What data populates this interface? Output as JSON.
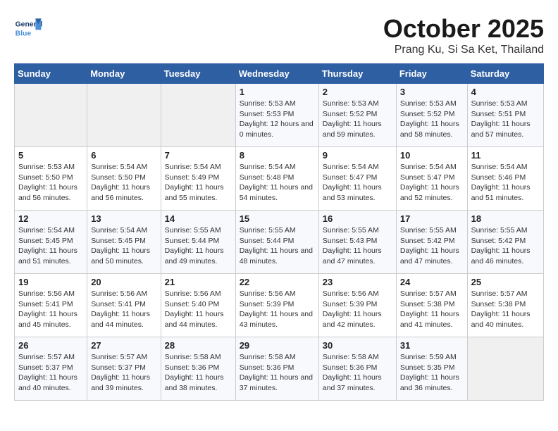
{
  "logo": {
    "general": "General",
    "blue": "Blue"
  },
  "title": "October 2025",
  "subtitle": "Prang Ku, Si Sa Ket, Thailand",
  "headers": [
    "Sunday",
    "Monday",
    "Tuesday",
    "Wednesday",
    "Thursday",
    "Friday",
    "Saturday"
  ],
  "weeks": [
    [
      {
        "day": "",
        "sunrise": "",
        "sunset": "",
        "daylight": ""
      },
      {
        "day": "",
        "sunrise": "",
        "sunset": "",
        "daylight": ""
      },
      {
        "day": "",
        "sunrise": "",
        "sunset": "",
        "daylight": ""
      },
      {
        "day": "1",
        "sunrise": "Sunrise: 5:53 AM",
        "sunset": "Sunset: 5:53 PM",
        "daylight": "Daylight: 12 hours and 0 minutes."
      },
      {
        "day": "2",
        "sunrise": "Sunrise: 5:53 AM",
        "sunset": "Sunset: 5:52 PM",
        "daylight": "Daylight: 11 hours and 59 minutes."
      },
      {
        "day": "3",
        "sunrise": "Sunrise: 5:53 AM",
        "sunset": "Sunset: 5:52 PM",
        "daylight": "Daylight: 11 hours and 58 minutes."
      },
      {
        "day": "4",
        "sunrise": "Sunrise: 5:53 AM",
        "sunset": "Sunset: 5:51 PM",
        "daylight": "Daylight: 11 hours and 57 minutes."
      }
    ],
    [
      {
        "day": "5",
        "sunrise": "Sunrise: 5:53 AM",
        "sunset": "Sunset: 5:50 PM",
        "daylight": "Daylight: 11 hours and 56 minutes."
      },
      {
        "day": "6",
        "sunrise": "Sunrise: 5:54 AM",
        "sunset": "Sunset: 5:50 PM",
        "daylight": "Daylight: 11 hours and 56 minutes."
      },
      {
        "day": "7",
        "sunrise": "Sunrise: 5:54 AM",
        "sunset": "Sunset: 5:49 PM",
        "daylight": "Daylight: 11 hours and 55 minutes."
      },
      {
        "day": "8",
        "sunrise": "Sunrise: 5:54 AM",
        "sunset": "Sunset: 5:48 PM",
        "daylight": "Daylight: 11 hours and 54 minutes."
      },
      {
        "day": "9",
        "sunrise": "Sunrise: 5:54 AM",
        "sunset": "Sunset: 5:47 PM",
        "daylight": "Daylight: 11 hours and 53 minutes."
      },
      {
        "day": "10",
        "sunrise": "Sunrise: 5:54 AM",
        "sunset": "Sunset: 5:47 PM",
        "daylight": "Daylight: 11 hours and 52 minutes."
      },
      {
        "day": "11",
        "sunrise": "Sunrise: 5:54 AM",
        "sunset": "Sunset: 5:46 PM",
        "daylight": "Daylight: 11 hours and 51 minutes."
      }
    ],
    [
      {
        "day": "12",
        "sunrise": "Sunrise: 5:54 AM",
        "sunset": "Sunset: 5:45 PM",
        "daylight": "Daylight: 11 hours and 51 minutes."
      },
      {
        "day": "13",
        "sunrise": "Sunrise: 5:54 AM",
        "sunset": "Sunset: 5:45 PM",
        "daylight": "Daylight: 11 hours and 50 minutes."
      },
      {
        "day": "14",
        "sunrise": "Sunrise: 5:55 AM",
        "sunset": "Sunset: 5:44 PM",
        "daylight": "Daylight: 11 hours and 49 minutes."
      },
      {
        "day": "15",
        "sunrise": "Sunrise: 5:55 AM",
        "sunset": "Sunset: 5:44 PM",
        "daylight": "Daylight: 11 hours and 48 minutes."
      },
      {
        "day": "16",
        "sunrise": "Sunrise: 5:55 AM",
        "sunset": "Sunset: 5:43 PM",
        "daylight": "Daylight: 11 hours and 47 minutes."
      },
      {
        "day": "17",
        "sunrise": "Sunrise: 5:55 AM",
        "sunset": "Sunset: 5:42 PM",
        "daylight": "Daylight: 11 hours and 47 minutes."
      },
      {
        "day": "18",
        "sunrise": "Sunrise: 5:55 AM",
        "sunset": "Sunset: 5:42 PM",
        "daylight": "Daylight: 11 hours and 46 minutes."
      }
    ],
    [
      {
        "day": "19",
        "sunrise": "Sunrise: 5:56 AM",
        "sunset": "Sunset: 5:41 PM",
        "daylight": "Daylight: 11 hours and 45 minutes."
      },
      {
        "day": "20",
        "sunrise": "Sunrise: 5:56 AM",
        "sunset": "Sunset: 5:41 PM",
        "daylight": "Daylight: 11 hours and 44 minutes."
      },
      {
        "day": "21",
        "sunrise": "Sunrise: 5:56 AM",
        "sunset": "Sunset: 5:40 PM",
        "daylight": "Daylight: 11 hours and 44 minutes."
      },
      {
        "day": "22",
        "sunrise": "Sunrise: 5:56 AM",
        "sunset": "Sunset: 5:39 PM",
        "daylight": "Daylight: 11 hours and 43 minutes."
      },
      {
        "day": "23",
        "sunrise": "Sunrise: 5:56 AM",
        "sunset": "Sunset: 5:39 PM",
        "daylight": "Daylight: 11 hours and 42 minutes."
      },
      {
        "day": "24",
        "sunrise": "Sunrise: 5:57 AM",
        "sunset": "Sunset: 5:38 PM",
        "daylight": "Daylight: 11 hours and 41 minutes."
      },
      {
        "day": "25",
        "sunrise": "Sunrise: 5:57 AM",
        "sunset": "Sunset: 5:38 PM",
        "daylight": "Daylight: 11 hours and 40 minutes."
      }
    ],
    [
      {
        "day": "26",
        "sunrise": "Sunrise: 5:57 AM",
        "sunset": "Sunset: 5:37 PM",
        "daylight": "Daylight: 11 hours and 40 minutes."
      },
      {
        "day": "27",
        "sunrise": "Sunrise: 5:57 AM",
        "sunset": "Sunset: 5:37 PM",
        "daylight": "Daylight: 11 hours and 39 minutes."
      },
      {
        "day": "28",
        "sunrise": "Sunrise: 5:58 AM",
        "sunset": "Sunset: 5:36 PM",
        "daylight": "Daylight: 11 hours and 38 minutes."
      },
      {
        "day": "29",
        "sunrise": "Sunrise: 5:58 AM",
        "sunset": "Sunset: 5:36 PM",
        "daylight": "Daylight: 11 hours and 37 minutes."
      },
      {
        "day": "30",
        "sunrise": "Sunrise: 5:58 AM",
        "sunset": "Sunset: 5:36 PM",
        "daylight": "Daylight: 11 hours and 37 minutes."
      },
      {
        "day": "31",
        "sunrise": "Sunrise: 5:59 AM",
        "sunset": "Sunset: 5:35 PM",
        "daylight": "Daylight: 11 hours and 36 minutes."
      },
      {
        "day": "",
        "sunrise": "",
        "sunset": "",
        "daylight": ""
      }
    ]
  ]
}
